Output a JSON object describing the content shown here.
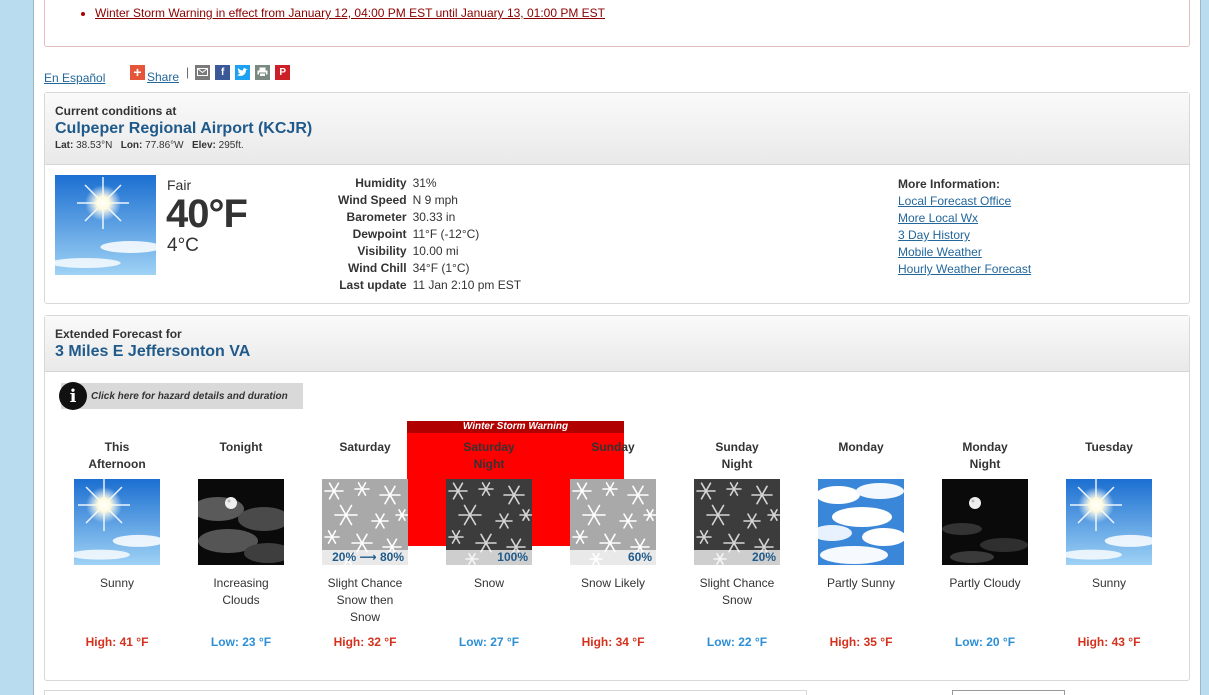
{
  "hazard": {
    "text": "Winter Storm Warning in effect from January 12, 04:00 PM EST until January 13, 01:00 PM EST"
  },
  "links": {
    "espanol": "En Español",
    "share": "Share"
  },
  "current": {
    "header_small": "Current conditions at",
    "station": "Culpeper Regional Airport (KCJR)",
    "lat_label": "Lat:",
    "lat": "38.53°N",
    "lon_label": "Lon:",
    "lon": "77.86°W",
    "elev_label": "Elev:",
    "elev": "295ft.",
    "condition": "Fair",
    "temp_f": "40°F",
    "temp_c": "4°C",
    "details": [
      {
        "label": "Humidity",
        "value": "31%"
      },
      {
        "label": "Wind Speed",
        "value": "N 9 mph"
      },
      {
        "label": "Barometer",
        "value": "30.33 in"
      },
      {
        "label": "Dewpoint",
        "value": "11°F (-12°C)"
      },
      {
        "label": "Visibility",
        "value": "10.00 mi"
      },
      {
        "label": "Wind Chill",
        "value": "34°F (1°C)"
      },
      {
        "label": "Last update",
        "value": "11 Jan 2:10 pm EST"
      }
    ],
    "more_info_title": "More Information:",
    "more_info_links": [
      "Local Forecast Office",
      "More Local Wx",
      "3 Day History",
      "Mobile Weather",
      "Hourly Weather Forecast"
    ]
  },
  "extended": {
    "header_small": "Extended Forecast for",
    "location": "3 Miles E Jeffersonton VA",
    "hazard_button": "Click here for hazard details and duration",
    "warning_band": "Winter Storm Warning",
    "periods": [
      {
        "name1": "This",
        "name2": "Afternoon",
        "icon": "sunny",
        "pop": "",
        "desc": [
          "Sunny"
        ],
        "temp": "High: 41 °F",
        "kind": "hi"
      },
      {
        "name1": "Tonight",
        "name2": "",
        "icon": "night-cloudy",
        "pop": "",
        "desc": [
          "Increasing",
          "Clouds"
        ],
        "temp": "Low: 23 °F",
        "kind": "lo"
      },
      {
        "name1": "Saturday",
        "name2": "",
        "icon": "snow-day",
        "pop": "20% ⟶ 80%",
        "desc": [
          "Slight Chance",
          "Snow then",
          "Snow"
        ],
        "temp": "High: 32 °F",
        "kind": "hi"
      },
      {
        "name1": "Saturday",
        "name2": "Night",
        "icon": "snow-night",
        "pop": "100%",
        "desc": [
          "Snow"
        ],
        "temp": "Low: 27 °F",
        "kind": "lo"
      },
      {
        "name1": "Sunday",
        "name2": "",
        "icon": "snow-day",
        "pop": "60%",
        "desc": [
          "Snow Likely"
        ],
        "temp": "High: 34 °F",
        "kind": "hi"
      },
      {
        "name1": "Sunday",
        "name2": "Night",
        "icon": "snow-night",
        "pop": "20%",
        "desc": [
          "Slight Chance",
          "Snow"
        ],
        "temp": "Low: 22 °F",
        "kind": "lo"
      },
      {
        "name1": "Monday",
        "name2": "",
        "icon": "partly-sunny",
        "pop": "",
        "desc": [
          "Partly Sunny"
        ],
        "temp": "High: 35 °F",
        "kind": "hi"
      },
      {
        "name1": "Monday",
        "name2": "Night",
        "icon": "night-partly",
        "pop": "",
        "desc": [
          "Partly Cloudy"
        ],
        "temp": "Low: 20 °F",
        "kind": "lo"
      },
      {
        "name1": "Tuesday",
        "name2": "",
        "icon": "sunny",
        "pop": "",
        "desc": [
          "Sunny"
        ],
        "temp": "High: 43 °F",
        "kind": "hi"
      }
    ]
  },
  "colors": {
    "high": "#d2321e",
    "low": "#2c8fd6",
    "warning": "#ff0000",
    "link": "#23679b"
  }
}
